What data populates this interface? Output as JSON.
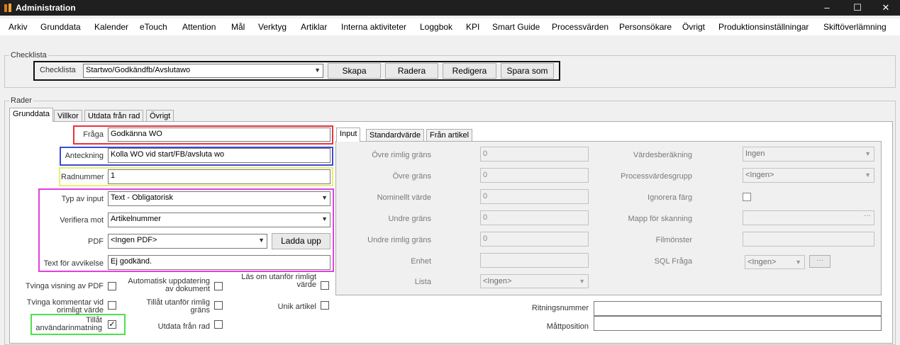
{
  "window": {
    "title": "Administration",
    "minimize": "–",
    "maximize": "☐",
    "close": "✕"
  },
  "menu": [
    "Arkiv",
    "Grunddata",
    "Kalender",
    "eTouch",
    "Attention",
    "Mål",
    "Verktyg",
    "Artiklar",
    "Interna aktiviteter",
    "Loggbok",
    "KPI",
    "Smart Guide",
    "Processvärden",
    "Personsökare",
    "Övrigt",
    "Produktionsinställningar",
    "Skiftöverlämning"
  ],
  "checklist_group": {
    "legend": "Checklista",
    "label": "Checklista",
    "selected": "Startwo/Godkändfb/Avslutawo",
    "buttons": {
      "create": "Skapa",
      "delete": "Radera",
      "edit": "Redigera",
      "save_as": "Spara som"
    }
  },
  "rows_group": {
    "legend": "Rader"
  },
  "tabs": [
    "Grunddata",
    "Villkor",
    "Utdata från rad",
    "Övrigt"
  ],
  "form": {
    "question": {
      "label": "Fråga",
      "value": "Godkänna WO"
    },
    "note": {
      "label": "Anteckning",
      "value": "Kolla WO vid start/FB/avsluta wo"
    },
    "row_number": {
      "label": "Radnummer",
      "value": "1"
    },
    "input_type": {
      "label": "Typ av input",
      "value": "Text - Obligatorisk"
    },
    "verify_against": {
      "label": "Verifiera mot",
      "value": "Artikelnummer"
    },
    "pdf": {
      "label": "PDF",
      "value": "<Ingen PDF>",
      "upload": "Ladda upp"
    },
    "deviation_text": {
      "label": "Text för avvikelse",
      "value": "Ej godkänd."
    }
  },
  "checkboxes": {
    "force_pdf": {
      "label": "Tvinga visning av PDF",
      "checked": false
    },
    "auto_update": {
      "label": "Automatisk uppdatering av dokument",
      "checked": false
    },
    "read_outside": {
      "label": "Läs om utanför rimligt värde",
      "checked": false
    },
    "force_comment": {
      "label": "Tvinga kommentar vid orimligt värde",
      "checked": false
    },
    "allow_outside": {
      "label": "Tillåt utanför rimlig gräns",
      "checked": false
    },
    "unique_article": {
      "label": "Unik artikel",
      "checked": false
    },
    "allow_user_input": {
      "label": "Tillåt användarinmatning",
      "checked": true,
      "mark": "✓"
    },
    "output_from_row": {
      "label": "Utdata från rad",
      "checked": false
    }
  },
  "inner_tabs": [
    "Input",
    "Standardvärde",
    "Från artikel"
  ],
  "input_panel": {
    "upper_reasonable": {
      "label": "Övre rimlig gräns",
      "value": "0"
    },
    "upper_limit": {
      "label": "Övre gräns",
      "value": "0"
    },
    "nominal": {
      "label": "Nominellt värde",
      "value": "0"
    },
    "lower_limit": {
      "label": "Undre gräns",
      "value": "0"
    },
    "lower_reasonable": {
      "label": "Undre rimlig gräns",
      "value": "0"
    },
    "unit": {
      "label": "Enhet",
      "value": ""
    },
    "list": {
      "label": "Lista",
      "value": "<Ingen>"
    },
    "value_calc": {
      "label": "Värdesberäkning",
      "value": "Ingen"
    },
    "process_group": {
      "label": "Processvärdesgrupp",
      "value": "<Ingen>"
    },
    "ignore_color": {
      "label": "Ignorera färg"
    },
    "scan_folder": {
      "label": "Mapp för skanning",
      "value": "",
      "browse": "···"
    },
    "file_pattern": {
      "label": "Filmönster",
      "value": ""
    },
    "sql_query": {
      "label": "SQL Fråga",
      "value": "<Ingen>",
      "browse": "···"
    }
  },
  "bottom": {
    "drawing_number": {
      "label": "Ritningsnummer",
      "value": ""
    },
    "measure_position": {
      "label": "Måttposition",
      "value": ""
    }
  },
  "colors": {
    "red": "#e8333a",
    "blue": "#3b4bd8",
    "yellow": "#e7ef70",
    "magenta": "#e040e0",
    "green": "#4de04d"
  }
}
